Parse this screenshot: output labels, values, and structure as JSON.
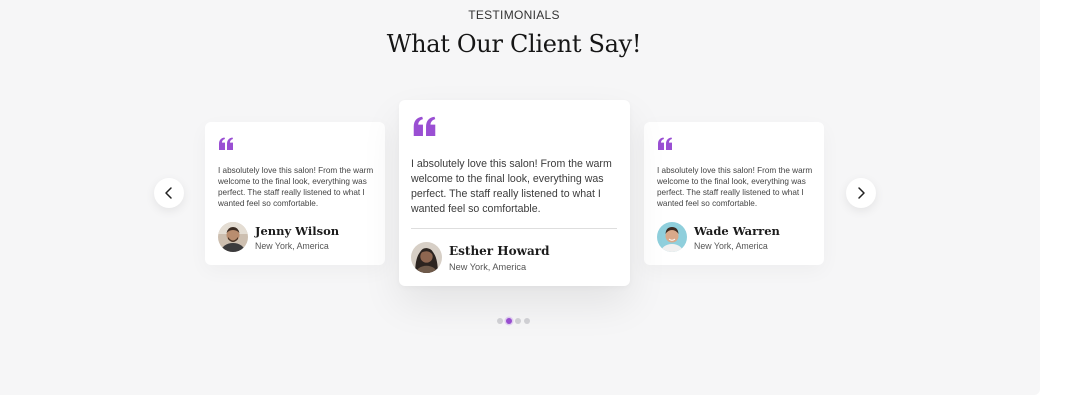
{
  "section": {
    "eyebrow": "TESTIMONIALS",
    "heading": "What Our Client Say!"
  },
  "testimonials": [
    {
      "quote": "I absolutely love this salon! From the warm welcome to the final look, everything was perfect. The staff really listened to what I wanted feel so comfortable.",
      "name": "Jenny Wilson",
      "location": "New York, America",
      "avatar": "avatar-jenny"
    },
    {
      "quote": "I absolutely love this salon! From the warm welcome to the final look, everything was perfect. The staff really listened to what I wanted feel so comfortable.",
      "name": "Esther Howard",
      "location": "New York, America",
      "avatar": "avatar-esther"
    },
    {
      "quote": "I absolutely love this salon! From the warm welcome to the final look, everything was perfect. The staff really listened to what I wanted feel so comfortable.",
      "name": "Wade Warren",
      "location": "New York, America",
      "avatar": "avatar-wade"
    }
  ],
  "carousel": {
    "prev_icon": "chevron-left-icon",
    "next_icon": "chevron-right-icon",
    "dot_count": 4,
    "active_dot": 2
  },
  "colors": {
    "accent": "#9a4fd3",
    "background": "#f6f6f7",
    "card": "#ffffff"
  }
}
